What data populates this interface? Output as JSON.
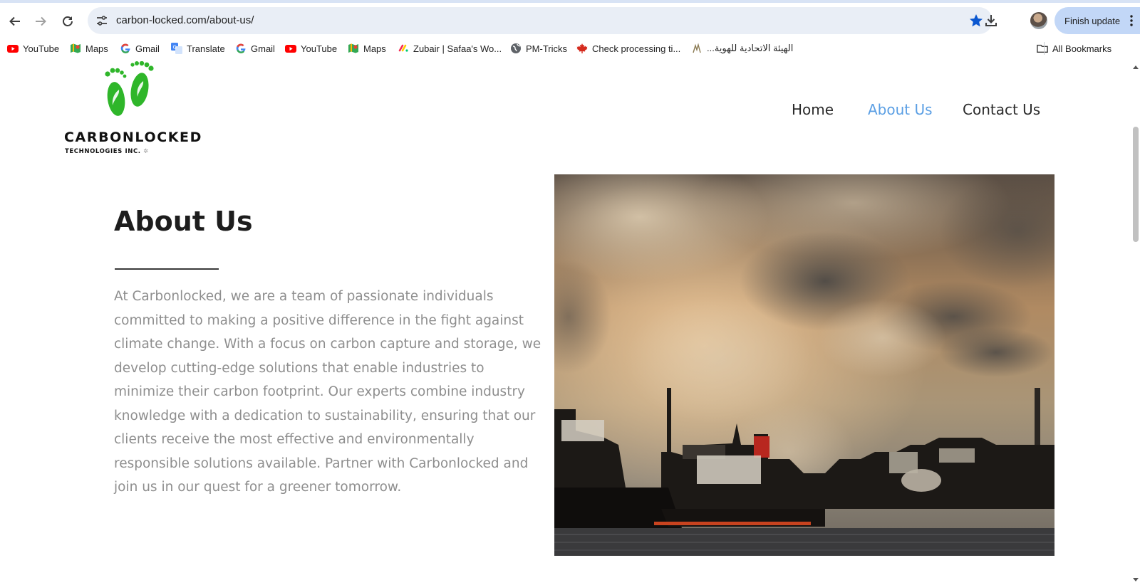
{
  "browser": {
    "url": "carbon-locked.com/about-us/",
    "finish_update_label": "Finish update",
    "bookmarks": [
      {
        "label": "YouTube",
        "icon": "youtube-icon"
      },
      {
        "label": "Maps",
        "icon": "maps-icon"
      },
      {
        "label": "Gmail",
        "icon": "google-icon"
      },
      {
        "label": "Translate",
        "icon": "translate-icon"
      },
      {
        "label": "Gmail",
        "icon": "google-icon"
      },
      {
        "label": "YouTube",
        "icon": "youtube-icon"
      },
      {
        "label": "Maps",
        "icon": "maps-icon"
      },
      {
        "label": "Zubair | Safaa's Wo...",
        "icon": "monday-icon"
      },
      {
        "label": "PM-Tricks",
        "icon": "globe-icon"
      },
      {
        "label": "Check processing ti...",
        "icon": "maple-leaf-icon"
      },
      {
        "label": "الهيئة الاتحادية للهوية...",
        "icon": "uae-emblem-icon"
      }
    ],
    "all_bookmarks_label": "All Bookmarks"
  },
  "site": {
    "logo": {
      "name": "CARBONLOCKED",
      "subtitle": "TECHNOLOGIES INC."
    },
    "nav": [
      {
        "label": "Home",
        "active": false
      },
      {
        "label": "About Us",
        "active": true
      },
      {
        "label": "Contact Us",
        "active": false
      }
    ],
    "about": {
      "heading": "About Us",
      "body": "At Carbonlocked, we are a team of passionate individuals committed to making a positive difference in the fight against climate change. With a focus on carbon capture and storage, we develop cutting-edge solutions that enable industries to minimize their carbon footprint. Our experts combine industry knowledge with a dedication to sustainability, ensuring that our clients receive the most effective and environmentally responsible solutions available. Partner with Carbonlocked and join us in our quest for a greener tomorrow."
    }
  },
  "colors": {
    "accent_nav": "#5b9fe4",
    "logo_green": "#2fb62a",
    "body_text": "#8e8e8e",
    "heading": "#1d1d1d"
  }
}
